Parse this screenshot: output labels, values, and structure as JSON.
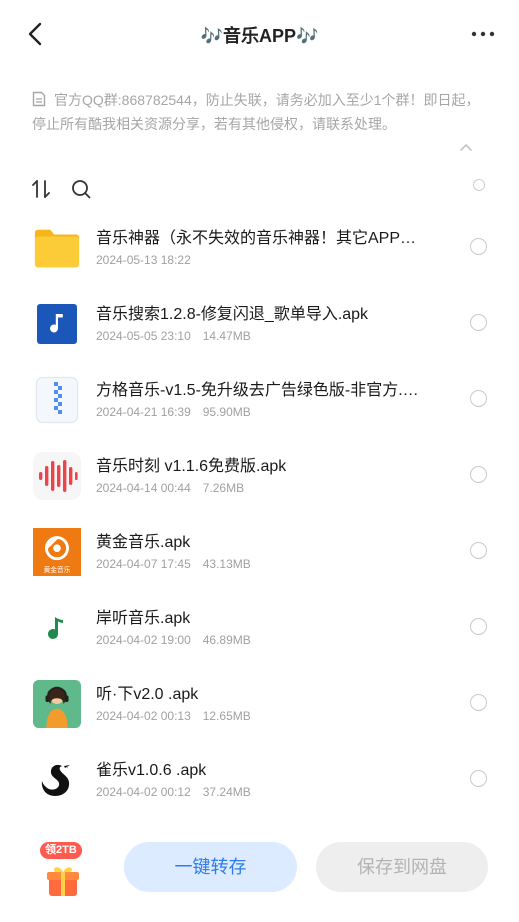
{
  "header": {
    "title": "🎶音乐APP🎶"
  },
  "notice": {
    "text": "官方QQ群:868782544，防止失联，请务必加入至少1个群！即日起，停止所有酷我相关资源分享，若有其他侵权，请联系处理。"
  },
  "files": [
    {
      "name": "音乐神器（永不失效的音乐神器！其它APP…",
      "date": "2024-05-13 18:22",
      "size": "",
      "icon": "folder-icon"
    },
    {
      "name": "音乐搜索1.2.8-修复闪退_歌单导入.apk",
      "date": "2024-05-05 23:10",
      "size": "14.47MB",
      "icon": "music-note-app-icon"
    },
    {
      "name": "方格音乐-v1.5-免升级去广告绿色版-非官方.…",
      "date": "2024-04-21 16:39",
      "size": "95.90MB",
      "icon": "zip-archive-icon"
    },
    {
      "name": "音乐时刻 v1.1.6免费版.apk",
      "date": "2024-04-14 00:44",
      "size": "7.26MB",
      "icon": "soundwave-app-icon"
    },
    {
      "name": "黄金音乐.apk",
      "date": "2024-04-07 17:45",
      "size": "43.13MB",
      "icon": "golden-music-app-icon"
    },
    {
      "name": "岸听音乐.apk",
      "date": "2024-04-02 19:00",
      "size": "46.89MB",
      "icon": "green-note-app-icon"
    },
    {
      "name": "听·下v2.0 .apk",
      "date": "2024-04-02 00:13",
      "size": "12.65MB",
      "icon": "headphone-girl-app-icon"
    },
    {
      "name": "雀乐v1.0.6 .apk",
      "date": "2024-04-02 00:12",
      "size": "37.24MB",
      "icon": "swan-app-icon"
    }
  ],
  "gift_badge": {
    "label": "领2TB"
  },
  "buttons": {
    "transfer": "一键转存",
    "save": "保存到网盘"
  },
  "golden_icon_caption": "黄金音乐",
  "colors": {
    "accent": "#2c7cf0",
    "transfer_bg": "#dcebff",
    "disabled_bg": "#eeeeee",
    "folder": "#f9c22e",
    "badge": "#ff5a4e"
  }
}
